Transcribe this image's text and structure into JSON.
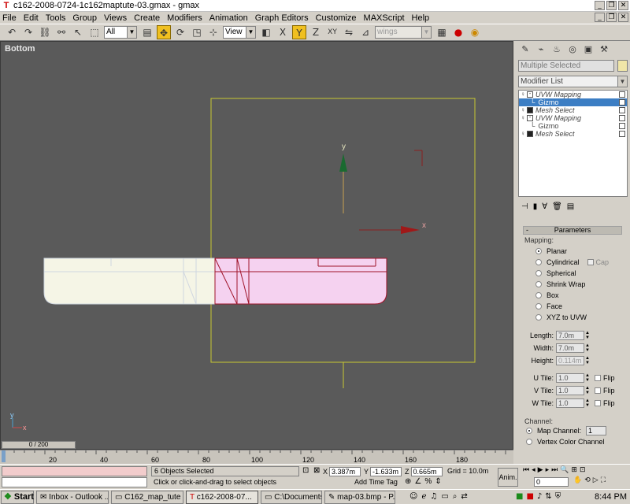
{
  "window": {
    "title": "c162-2008-0724-1c162maptute-03.gmax - gmax"
  },
  "menu": [
    "File",
    "Edit",
    "Tools",
    "Group",
    "Views",
    "Create",
    "Modifiers",
    "Animation",
    "Graph Editors",
    "Customize",
    "MAXScript",
    "Help"
  ],
  "toolbar": {
    "filter_value": "All",
    "coord_system": "View",
    "named_selection": "wings"
  },
  "viewport": {
    "label": "Bottom",
    "gizmo_x_label": "x",
    "gizmo_y_label": "y",
    "corner_axis_y": "y",
    "corner_axis_x": "x"
  },
  "panel": {
    "selection_name": "Multiple Selected",
    "modifier_list": "Modifier List",
    "stack": [
      {
        "name": "UVW Mapping",
        "type": "modifier",
        "selected": false
      },
      {
        "name": "Gizmo",
        "type": "sub",
        "selected": true
      },
      {
        "name": "Mesh Select",
        "type": "modifier",
        "selected": false
      },
      {
        "name": "UVW Mapping",
        "type": "modifier",
        "selected": false
      },
      {
        "name": "Gizmo",
        "type": "sub",
        "selected": false
      },
      {
        "name": "Mesh Select",
        "type": "modifier",
        "selected": false
      }
    ],
    "rollout_title": "Parameters",
    "rollout_minus": "-",
    "mapping_label": "Mapping:",
    "mapping_options": [
      "Planar",
      "Cylindrical",
      "Spherical",
      "Shrink Wrap",
      "Box",
      "Face",
      "XYZ to UVW"
    ],
    "cap_label": "Cap",
    "length_label": "Length:",
    "length_value": "7.0m",
    "width_label": "Width:",
    "width_value": "7.0m",
    "height_label": "Height:",
    "height_value": "0.114m",
    "utile_label": "U Tile:",
    "utile_value": "1.0",
    "vtile_label": "V Tile:",
    "vtile_value": "1.0",
    "wtile_label": "W Tile:",
    "wtile_value": "1.0",
    "flip_label": "Flip",
    "channel_label": "Channel:",
    "map_channel_label": "Map Channel:",
    "map_channel_value": "1",
    "vertex_color_label": "Vertex Color Channel"
  },
  "timeline": {
    "slider_text": "0 / 200",
    "ticks": [
      "20",
      "40",
      "60",
      "80",
      "100",
      "120",
      "140",
      "160",
      "180"
    ]
  },
  "status": {
    "selection_count": "6 Objects Selected",
    "prompt": "Click or click-and-drag to select objects",
    "x_label": "X",
    "x_value": "3.387m",
    "y_label": "Y",
    "y_value": "-1.633m",
    "z_label": "Z",
    "z_value": "0.665m",
    "grid": "Grid = 10.0m",
    "add_time_tag": "Add Time Tag",
    "anim_label": "Anim.",
    "frame_value": "0"
  },
  "taskbar": {
    "start": "Start",
    "tasks": [
      "Inbox - Outlook ...",
      "C162_map_tute",
      "c162-2008-07...",
      "C:\\Documents a...",
      "map-03.bmp - P..."
    ],
    "active_task_index": 2,
    "clock": "8:44 PM"
  },
  "colors": {
    "viewport_bg": "#5a5a5a",
    "gizmo_yellow": "#c8c832",
    "selected_pink": "#f5d2f0",
    "unselected_cream": "#f5f5e6",
    "selection_red": "#a0142a",
    "stack_highlight": "#3c7ec4"
  }
}
